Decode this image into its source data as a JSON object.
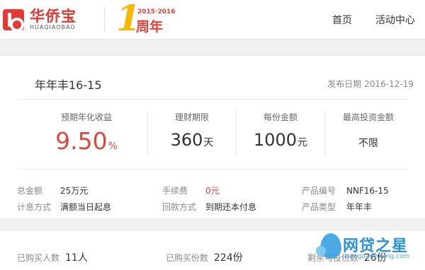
{
  "brand": {
    "name_cn": "华侨宝",
    "name_en": "HUAQIAOBAO",
    "anniversary_years": "2015·2016",
    "anniversary_number": "1",
    "anniversary_label": "周年"
  },
  "nav": {
    "home": "首页",
    "activity": "活动中心"
  },
  "product": {
    "title": "年年丰16-15",
    "publish_label": "发布日期",
    "publish_date": "2016-12-19"
  },
  "stats": [
    {
      "label": "预期年化收益",
      "value": "9.50",
      "unit": "%"
    },
    {
      "label": "理财期限",
      "value": "360",
      "unit": "天"
    },
    {
      "label": "每份金额",
      "value": "1000",
      "unit": "元"
    },
    {
      "label": "最高投资金额",
      "value": "不限",
      "unit": ""
    }
  ],
  "details": {
    "total_label": "总金额",
    "total_value": "25万元",
    "fee_label": "手续费",
    "fee_value": "0元",
    "code_label": "产品编号",
    "code_value": "NNF16-15",
    "interest_label": "计息方式",
    "interest_value": "满额当日起息",
    "repay_label": "回款方式",
    "repay_value": "到期还本付息",
    "type_label": "产品类型",
    "type_value": "年年丰"
  },
  "purchase": {
    "buyers_label": "已购买人数",
    "buyers_value": "11人",
    "bought_label": "已购买份数",
    "bought_value": "224份",
    "remain_label": "剩余可投份数",
    "remain_value": "26份"
  },
  "watermark": {
    "text": "网贷之星",
    "sub": "wangdaizhixing.com"
  },
  "colors": {
    "accent_red": "#d74a3f",
    "brand_red": "#d83a2f",
    "anniversary_gold": "#f5b700",
    "watermark_blue": "#2b92d8"
  }
}
